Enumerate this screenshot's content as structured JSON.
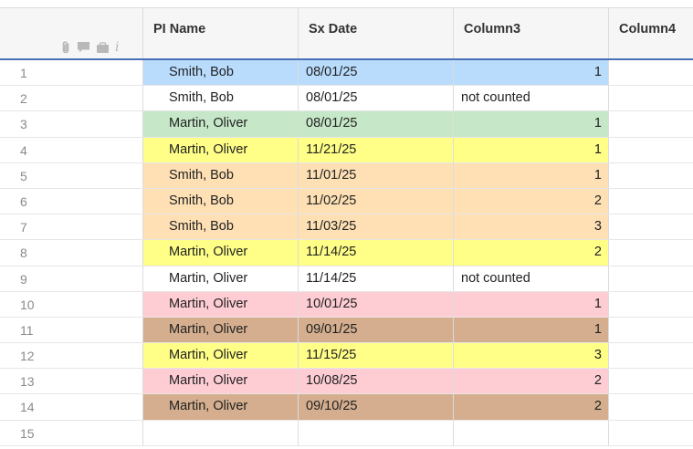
{
  "columns": {
    "c1": "PI Name",
    "c2": "Sx Date",
    "c3": "Column3",
    "c4": "Column4"
  },
  "header_icons": [
    "paperclip-icon",
    "comment-icon",
    "card-icon",
    "info-icon"
  ],
  "info_glyph": "i",
  "colors": {
    "blue": "#b9dcfd",
    "green": "#c6e8c9",
    "yellow": "#ffff88",
    "orange": "#fee0b4",
    "pink": "#fecdd4",
    "brown": "#d4ae8e",
    "white": "#ffffff"
  },
  "rows": [
    {
      "num": "1",
      "name": "Smith, Bob",
      "date": "08/01/25",
      "col3": "1",
      "col3_numeric": true,
      "color": "blue"
    },
    {
      "num": "2",
      "name": "Smith, Bob",
      "date": "08/01/25",
      "col3": "not counted",
      "col3_numeric": false,
      "color": "white"
    },
    {
      "num": "3",
      "name": "Martin, Oliver",
      "date": "08/01/25",
      "col3": "1",
      "col3_numeric": true,
      "color": "green"
    },
    {
      "num": "4",
      "name": "Martin, Oliver",
      "date": "11/21/25",
      "col3": "1",
      "col3_numeric": true,
      "color": "yellow"
    },
    {
      "num": "5",
      "name": "Smith, Bob",
      "date": "11/01/25",
      "col3": "1",
      "col3_numeric": true,
      "color": "orange"
    },
    {
      "num": "6",
      "name": "Smith, Bob",
      "date": "11/02/25",
      "col3": "2",
      "col3_numeric": true,
      "color": "orange"
    },
    {
      "num": "7",
      "name": "Smith, Bob",
      "date": "11/03/25",
      "col3": "3",
      "col3_numeric": true,
      "color": "orange"
    },
    {
      "num": "8",
      "name": "Martin, Oliver",
      "date": "11/14/25",
      "col3": "2",
      "col3_numeric": true,
      "color": "yellow"
    },
    {
      "num": "9",
      "name": "Martin, Oliver",
      "date": "11/14/25",
      "col3": "not counted",
      "col3_numeric": false,
      "color": "white"
    },
    {
      "num": "10",
      "name": "Martin, Oliver",
      "date": "10/01/25",
      "col3": "1",
      "col3_numeric": true,
      "color": "pink"
    },
    {
      "num": "11",
      "name": "Martin, Oliver",
      "date": "09/01/25",
      "col3": "1",
      "col3_numeric": true,
      "color": "brown"
    },
    {
      "num": "12",
      "name": "Martin, Oliver",
      "date": "11/15/25",
      "col3": "3",
      "col3_numeric": true,
      "color": "yellow"
    },
    {
      "num": "13",
      "name": "Martin, Oliver",
      "date": "10/08/25",
      "col3": "2",
      "col3_numeric": true,
      "color": "pink"
    },
    {
      "num": "14",
      "name": "Martin, Oliver",
      "date": "09/10/25",
      "col3": "2",
      "col3_numeric": true,
      "color": "brown"
    },
    {
      "num": "15",
      "name": "",
      "date": "",
      "col3": "",
      "col3_numeric": false,
      "color": "white"
    }
  ]
}
